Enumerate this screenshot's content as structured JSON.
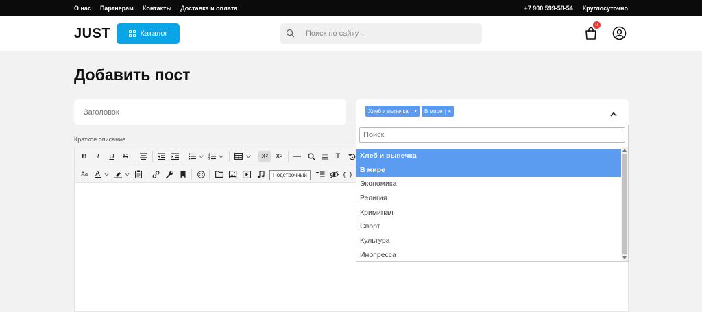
{
  "topbar": {
    "links": [
      "О нас",
      "Партнерам",
      "Контакты",
      "Доставка и оплата"
    ],
    "phone": "+7 900 599-58-54",
    "hours": "Круглосуточно"
  },
  "header": {
    "logo": "JUST",
    "catalog_label": "Каталог",
    "search_placeholder": "Поиск по сайту...",
    "cart_count": "0"
  },
  "page": {
    "title": "Добавить пост",
    "title_placeholder": "Заголовок",
    "short_description_label": "Краткое описание"
  },
  "editor": {
    "tooltip": "Подстрочный",
    "toolbar_row1": [
      "bold",
      "italic",
      "underline",
      "strikethrough",
      "align-center",
      "outdent",
      "indent",
      "bullet-list",
      "numbered-list",
      "table",
      "subscript",
      "superscript",
      "horizontal-rule",
      "find",
      "align-justify",
      "text-format",
      "undo"
    ],
    "toolbar_row2": [
      "font-size",
      "font-color",
      "highlight-color",
      "paste",
      "link",
      "settings",
      "bookmark",
      "emoji",
      "file-manager",
      "image",
      "video",
      "audio",
      "special-chars",
      "show-blocks",
      "source-code"
    ]
  },
  "categories": {
    "selected": [
      "Хлеб и выпечка",
      "В мире"
    ],
    "search_placeholder": "Поиск",
    "options": [
      "Хлеб и выпечка",
      "В мире",
      "Экономика",
      "Религия",
      "Криминал",
      "Спорт",
      "Культура",
      "Инопресса"
    ]
  },
  "colors": {
    "accent": "#0aa5e6",
    "tag": "#5b9bf0",
    "badge": "#e53935"
  }
}
